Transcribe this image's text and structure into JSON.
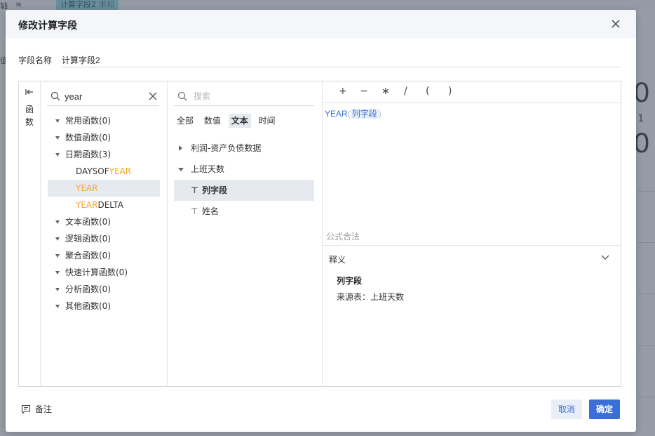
{
  "background": {
    "chip_label": "计算字段2",
    "chip_sub": "求和",
    "left_text_top": "轴",
    "left_text_mid": "值",
    "big_numbers": [
      "0",
      "0"
    ],
    "small_text": "1"
  },
  "dialog": {
    "title": "修改计算字段",
    "field_name_label": "字段名称",
    "field_name_value": "计算字段2"
  },
  "rail": {
    "label": "函数"
  },
  "functions": {
    "search_value": "year",
    "categories": [
      {
        "label": "常用函数(0)"
      },
      {
        "label": "数值函数(0)"
      },
      {
        "label": "日期函数(3)"
      },
      {
        "label": "文本函数(0)"
      },
      {
        "label": "逻辑函数(0)"
      },
      {
        "label": "聚合函数(0)"
      },
      {
        "label": "快速计算函数(0)"
      },
      {
        "label": "分析函数(0)"
      },
      {
        "label": "其他函数(0)"
      }
    ],
    "date_functions": [
      {
        "pre": "DAYSOF",
        "hl": "YEAR",
        "post": ""
      },
      {
        "pre": "",
        "hl": "YEAR",
        "post": ""
      },
      {
        "pre": "",
        "hl": "YEAR",
        "post": "DELTA"
      }
    ]
  },
  "fields": {
    "search_placeholder": "搜索",
    "type_tabs": [
      "全部",
      "数值",
      "文本",
      "时间"
    ],
    "active_tab": "文本",
    "tables": [
      {
        "label": "利润-资产负债数据",
        "expanded": false
      },
      {
        "label": "上班天数",
        "expanded": true
      }
    ],
    "columns": [
      {
        "label": "列字段",
        "selected": true
      },
      {
        "label": "姓名",
        "selected": false
      }
    ]
  },
  "formula": {
    "operators": [
      "+",
      "−",
      "∗",
      "/",
      "(",
      ")"
    ],
    "function_name": "YEAR",
    "open_paren": "(",
    "argument": "列字段",
    "close_paren": ")",
    "validity": "公式合法"
  },
  "explain": {
    "title": "释义",
    "field_name": "列字段",
    "source": "来源表：上班天数"
  },
  "footer": {
    "note_label": "备注",
    "cancel_label": "取消",
    "ok_label": "确定"
  },
  "colors": {
    "accent": "#3a6fd8",
    "highlight": "#f5a623",
    "selected_bg": "#e6e9f0"
  }
}
